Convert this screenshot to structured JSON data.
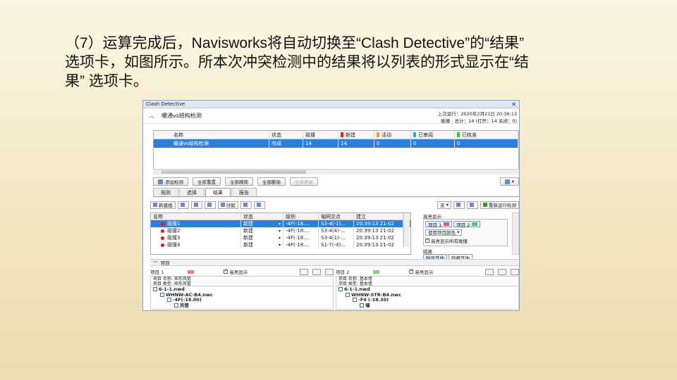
{
  "slide": {
    "line1": "（7）运算完成后，Navisworks将自动切换至“Clash Detective”的“结果”",
    "line2": "选项卡，如图所示。所本次冲突检测中的结果将以列表的形式显示在“结",
    "line3": "果” 选项卡。"
  },
  "window": {
    "title": "Clash Detective",
    "close": "✕",
    "test_name": "暖通vs结构检测",
    "last_run": "上次运行：2020年2月21日 20:39:13",
    "summary": "碰撞 - 总计：14 (打开：14 关闭：0)"
  },
  "tests_table": {
    "headers": [
      "名称",
      "状态",
      "碰撞",
      "新建",
      "活动",
      "已审阅",
      "已核准"
    ],
    "header_colors": [
      "",
      "",
      "",
      "#d9202a",
      "#f0a030",
      "#24b0e0",
      "#3cc03c"
    ],
    "rows": [
      [
        "暖通vs结构检测",
        "完成",
        "14",
        "14",
        "0",
        "0",
        "0"
      ]
    ]
  },
  "buttons": [
    "添加检测",
    "全部重置",
    "全部精简",
    "全部删除",
    "全部更新"
  ],
  "tabs": [
    "规则",
    "选择",
    "结果",
    "报告"
  ],
  "active_tab": "结果",
  "results_toolbar": {
    "new_group": "新建组",
    "assign": "分配",
    "none": "无",
    "rerun": "重新运行检测"
  },
  "results_table": {
    "headers": [
      "名称",
      "状态",
      "级别",
      "轴网交点",
      "建立"
    ],
    "rows": [
      [
        "碰撞1",
        "新建",
        "-4F(-18....",
        "S3-4(-1)...",
        "20:39:13 21-02"
      ],
      [
        "碰撞2",
        "新建",
        "-4F(-18....",
        "S3-4(4)-...",
        "20:39:13 21-02"
      ],
      [
        "碰撞3",
        "新建",
        "-4F(-18....",
        "S3-4(1)-...",
        "20:39:13 21-02"
      ],
      [
        "碰撞4",
        "新建",
        "-4F(-18....",
        "S1-7(-4)...",
        "20:39:13 21-02"
      ]
    ]
  },
  "highlight_panel": {
    "title": "高亮显示",
    "item1": "项目 1",
    "item1_color": "#e06060",
    "item2": "项目 2",
    "item2_color": "#60c060",
    "use_item_color": "使用项目颜色",
    "highlight_all": "高亮显示所有碰撞",
    "isolate_title": "隔离",
    "dim_others": "暗显其他",
    "hide_others": "隐藏其他"
  },
  "items_section": "项目",
  "item1": {
    "label": "项目 1",
    "color": "#e88080",
    "highlight": "高亮显示",
    "props": [
      "项目 名称: 矩形风管",
      "项目 类型: 矩形风管"
    ],
    "tree": [
      "6-1-1.nwd",
      "WHNW-AC-B4.nwc",
      "-4F(-18.00)",
      "风管"
    ]
  },
  "item2": {
    "label": "项目 2",
    "color": "#80d080",
    "highlight": "高亮显示",
    "props": [
      "项目 名称: 基本墙",
      "项目 类型: 基本墙"
    ],
    "tree": [
      "6-1-1.nwd",
      "WHNW-STR-B4.nwc",
      "-F4 (-18.30)",
      "墙"
    ]
  }
}
